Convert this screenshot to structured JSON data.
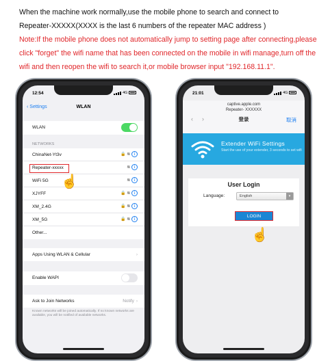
{
  "intro": {
    "line1": "When the machine work normally,use the mobile phone to search and connect to",
    "line2": "Repeater-XXXXX(XXXX is the last 6 numbers of the repeater MAC address )",
    "note": "Note:If the mobile phone does not automatically jump to setting page after connecting,please click \"forget\" the wifi name that has been connected on the mobile in wifi manage,turn off the wifi and then reopen the wifi to search it,or mobile browser input \"192.168.11.1\"."
  },
  "left_phone": {
    "time": "12:54",
    "network": "4G",
    "back_label": "Settings",
    "title": "WLAN",
    "wlan_label": "WLAN",
    "networks_header": "NETWORKS",
    "networks": [
      {
        "name": "ChinaNet-Yt3v",
        "lock": true
      },
      {
        "name": "Repeater-xxxxx",
        "lock": false
      },
      {
        "name": "WiFi 5G",
        "lock": false
      },
      {
        "name": "XJYFF",
        "lock": true
      },
      {
        "name": "XM_2.4G",
        "lock": true
      },
      {
        "name": "XM_5G",
        "lock": true
      },
      {
        "name": "Other...",
        "lock": false
      }
    ],
    "apps_using": "Apps Using WLAN & Cellular",
    "enable_wapi": "Enable WAPI",
    "ask_join": "Ask to Join Networks",
    "ask_join_value": "Notify",
    "footnote": "Known networks will be joined automatically. If no known networks are available, you will be notified of available networks."
  },
  "right_phone": {
    "time": "21:01",
    "network": "4G",
    "url_line1": "captive.apple.com",
    "url_line2": "Repeater- XXXXXX",
    "nav_title": "登录",
    "cancel": "取消",
    "banner_title": "Extender WiFi Settings",
    "banner_sub": "Start the use of your extender, 3 seconds to set wifi",
    "login_title": "User Login",
    "language_label": "Language:",
    "language_value": "English",
    "login_button": "LOGIN"
  },
  "colors": {
    "accent_red": "#e0262a",
    "ios_blue": "#1a7df0",
    "banner_blue": "#27a8e0",
    "toggle_green": "#4cd964"
  }
}
